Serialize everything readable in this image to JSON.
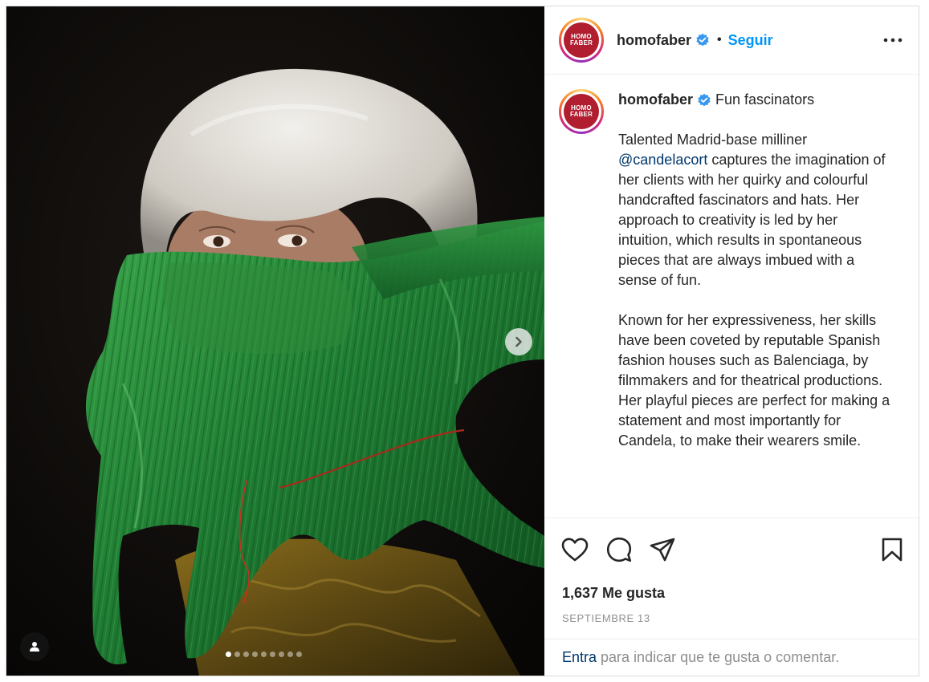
{
  "post": {
    "username": "homofaber",
    "avatar_text_line1": "HOMO",
    "avatar_text_line2": "FABER",
    "separator": "•",
    "follow_label": "Seguir",
    "caption_title": "Fun fascinators",
    "caption_p1_before": "Talented Madrid-base milliner ",
    "caption_mention": "@candelacort",
    "caption_p1_after": " captures the imagination of her clients with her quirky and colourful handcrafted fascinators and hats. Her approach to creativity is led by her intuition, which results in spontaneous pieces that are always imbued with a sense of fun.",
    "caption_p2": "Known for her expressiveness, her skills have been coveted by reputable Spanish fashion houses such as Balenciaga, by filmmakers and for theatrical productions. Her playful pieces are perfect for making a statement and most importantly for Candela, to make their wearers smile.",
    "likes": "1,637 Me gusta",
    "date": "SEPTIEMBRE 13",
    "footer_login": "Entra",
    "footer_rest": " para indicar que te gusta o comentar."
  },
  "media": {
    "carousel_total": 9,
    "carousel_active": 1
  },
  "icons": [
    "verified-badge-icon",
    "more-options-icon",
    "heart-icon",
    "comment-icon",
    "share-icon",
    "bookmark-icon",
    "chevron-right-icon",
    "user-tag-icon"
  ],
  "colors": {
    "accent_blue": "#0095f6",
    "mention_blue": "#00376b",
    "brand_red": "#b01e2f",
    "muted_text": "#8e8e8e"
  }
}
